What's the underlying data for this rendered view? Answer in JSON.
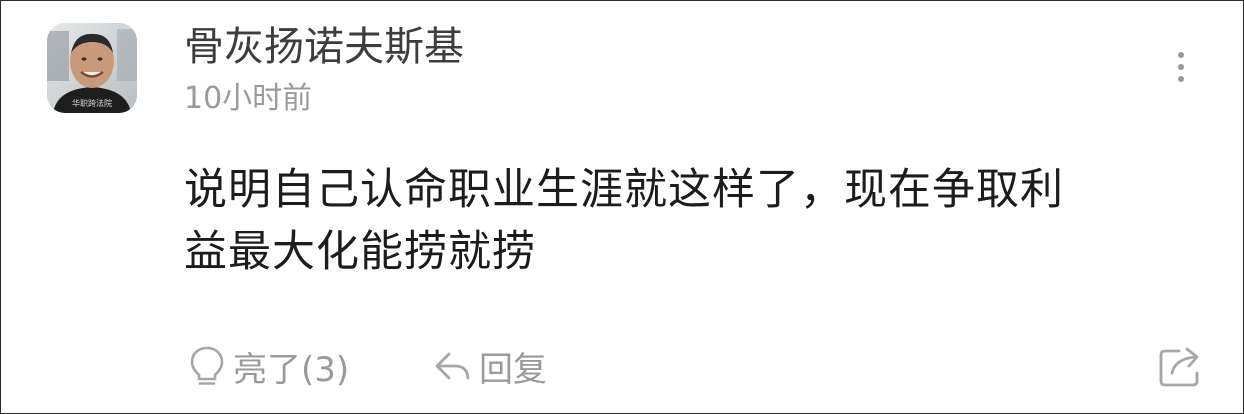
{
  "comment": {
    "username": "骨灰扬诺夫斯基",
    "timestamp": "10小时前",
    "content_lines": [
      "说明自己认命职业生涯就这样了，现在争取利",
      "益最大化能捞就捞"
    ]
  },
  "avatar": {
    "shirt_text": "华职跨法院"
  },
  "actions": {
    "like_label": "亮了(3)",
    "reply_label": "回复"
  },
  "icons": {
    "more": "more-vertical-icon",
    "like": "lightbulb-icon",
    "reply": "reply-arrow-icon",
    "share": "share-icon"
  },
  "colors": {
    "text_primary": "#1c1c1c",
    "username": "#3d3d3d",
    "muted": "#9a9a9a"
  }
}
